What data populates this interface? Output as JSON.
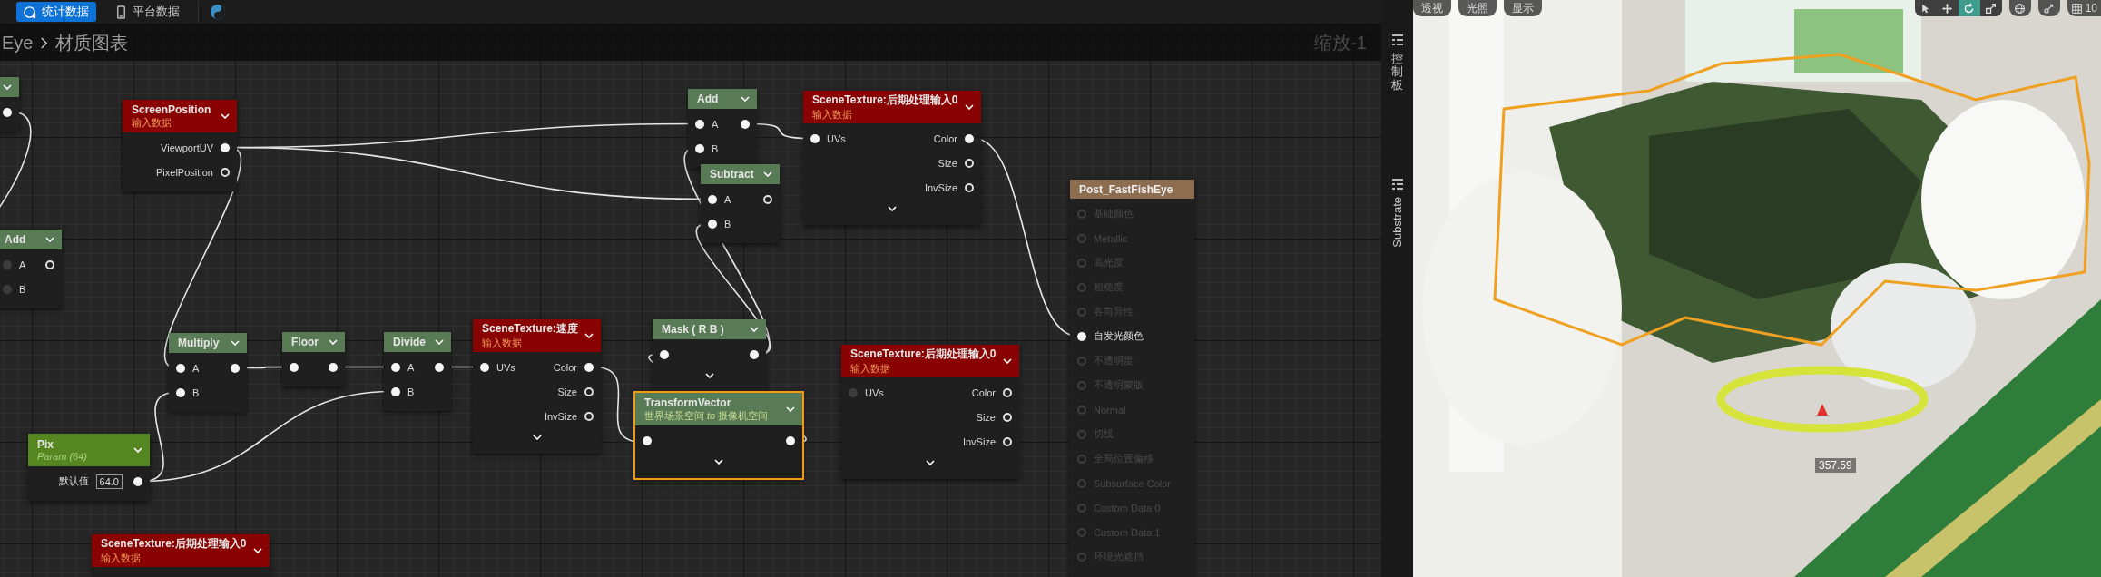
{
  "toolbar": [
    {
      "kind": "stats",
      "label": "统计数据",
      "selected": true
    },
    {
      "kind": "platform",
      "label": "平台数据",
      "selected": false
    }
  ],
  "breadcrumb": [
    "Eye",
    "材质图表"
  ],
  "zoom_label": "缩放-1",
  "side_tabs": [
    {
      "kind": "cjk",
      "label": "控制板"
    },
    {
      "kind": "latin",
      "label": "Substrate"
    }
  ],
  "nodes": [
    {
      "kind": "math",
      "selected": false,
      "outputs": [
        {
          "connected": true
        }
      ]
    },
    {
      "kind": "input",
      "title": "ScreenPosition",
      "subtitle": "输入数据",
      "selected": false,
      "outputs": [
        {
          "label": "ViewportUV",
          "connected": true
        },
        {
          "label": "PixelPosition",
          "connected": false
        }
      ]
    },
    {
      "kind": "math",
      "title": "Add",
      "selected": false,
      "inputs": [
        {
          "label": "A",
          "connected": false
        },
        {
          "label": "B",
          "connected": false
        }
      ],
      "outputs": [
        {
          "connected": false
        }
      ]
    },
    {
      "kind": "math",
      "title": "Add",
      "selected": false,
      "inputs": [
        {
          "label": "A",
          "connected": true
        },
        {
          "label": "B",
          "connected": true
        }
      ],
      "outputs": [
        {
          "connected": true
        }
      ]
    },
    {
      "kind": "math",
      "title": "Subtract",
      "selected": false,
      "inputs": [
        {
          "label": "A",
          "connected": true
        },
        {
          "label": "B",
          "connected": true
        }
      ],
      "outputs": [
        {
          "connected": false
        }
      ]
    },
    {
      "kind": "input",
      "title": "SceneTexture:后期处理输入0",
      "subtitle": "输入数据",
      "selected": false,
      "expandable": true,
      "inputs": [
        {
          "label": "UVs",
          "connected": true
        }
      ],
      "outputs": [
        {
          "label": "Color",
          "connected": true
        },
        {
          "label": "Size",
          "connected": false
        },
        {
          "label": "InvSize",
          "connected": false
        }
      ]
    },
    {
      "kind": "output",
      "title": "Post_FastFishEye",
      "selected": false,
      "inputs": [
        {
          "label": "基础颜色",
          "enabled": false,
          "connected": false
        },
        {
          "label": "Metallic",
          "enabled": false,
          "connected": false
        },
        {
          "label": "高光度",
          "enabled": false,
          "connected": false
        },
        {
          "label": "粗糙度",
          "enabled": false,
          "connected": false
        },
        {
          "label": "各向异性",
          "enabled": false,
          "connected": false
        },
        {
          "label": "自发光颜色",
          "enabled": true,
          "connected": true
        },
        {
          "label": "不透明度",
          "enabled": false,
          "connected": false
        },
        {
          "label": "不透明蒙版",
          "enabled": false,
          "connected": false
        },
        {
          "label": "Normal",
          "enabled": false,
          "connected": false
        },
        {
          "label": "切线",
          "enabled": false,
          "connected": false
        },
        {
          "label": "全局位置偏移",
          "enabled": false,
          "connected": false
        },
        {
          "label": "Subsurface Color",
          "enabled": false,
          "connected": false
        },
        {
          "label": "Custom Data 0",
          "enabled": false,
          "connected": false
        },
        {
          "label": "Custom Data 1",
          "enabled": false,
          "connected": false
        },
        {
          "label": "环境光遮挡",
          "enabled": false,
          "connected": false
        }
      ]
    },
    {
      "kind": "math",
      "title": "Multiply",
      "selected": false,
      "inputs": [
        {
          "label": "A",
          "connected": true
        },
        {
          "label": "B",
          "connected": true
        }
      ],
      "outputs": [
        {
          "connected": true
        }
      ]
    },
    {
      "kind": "math",
      "title": "Floor",
      "selected": false,
      "inputs": [
        {
          "connected": true
        }
      ],
      "outputs": [
        {
          "connected": true
        }
      ]
    },
    {
      "kind": "math",
      "title": "Divide",
      "selected": false,
      "inputs": [
        {
          "label": "A",
          "connected": true
        },
        {
          "label": "B",
          "connected": true
        }
      ],
      "outputs": [
        {
          "connected": true
        }
      ]
    },
    {
      "kind": "input",
      "title": "SceneTexture:速度",
      "subtitle": "输入数据",
      "selected": false,
      "expandable": true,
      "inputs": [
        {
          "label": "UVs",
          "connected": true
        }
      ],
      "outputs": [
        {
          "label": "Color",
          "connected": true
        },
        {
          "label": "Size",
          "connected": false
        },
        {
          "label": "InvSize",
          "connected": false
        }
      ]
    },
    {
      "kind": "math",
      "title": "Mask ( R B )",
      "selected": false,
      "expandable": true,
      "inputs": [
        {
          "connected": true
        }
      ],
      "outputs": [
        {
          "connected": true
        }
      ]
    },
    {
      "kind": "transform",
      "title": "TransformVector",
      "subtitle": "世界场景空间 *to* 摄像机空间",
      "selected": true,
      "expandable": true,
      "inputs": [
        {
          "connected": true
        }
      ],
      "outputs": [
        {
          "connected": true
        }
      ]
    },
    {
      "kind": "input",
      "title": "SceneTexture:后期处理输入0",
      "subtitle": "输入数据",
      "selected": false,
      "expandable": true,
      "inputs": [
        {
          "label": "UVs",
          "connected": false
        }
      ],
      "outputs": [
        {
          "label": "Color",
          "connected": false
        },
        {
          "label": "Size",
          "connected": false
        },
        {
          "label": "InvSize",
          "connected": false
        }
      ]
    },
    {
      "kind": "param",
      "title": "Pix",
      "subtitle": "Param (64)",
      "selected": false,
      "default": {
        "label": "默认值",
        "value": "64.0"
      },
      "outputs": [
        {
          "connected": true
        }
      ]
    },
    {
      "kind": "input",
      "title": "SceneTexture:后期处理输入0",
      "subtitle": "输入数据",
      "selected": false
    }
  ],
  "viewport": {
    "view_buttons": [
      "透视",
      "光照",
      "显示"
    ],
    "tools": [
      {
        "kind": "select",
        "selected": false
      },
      {
        "kind": "move",
        "selected": false
      },
      {
        "kind": "rotate",
        "selected": true
      },
      {
        "kind": "scale",
        "selected": false
      }
    ],
    "snap_value": "10",
    "measurement": "357.59"
  }
}
